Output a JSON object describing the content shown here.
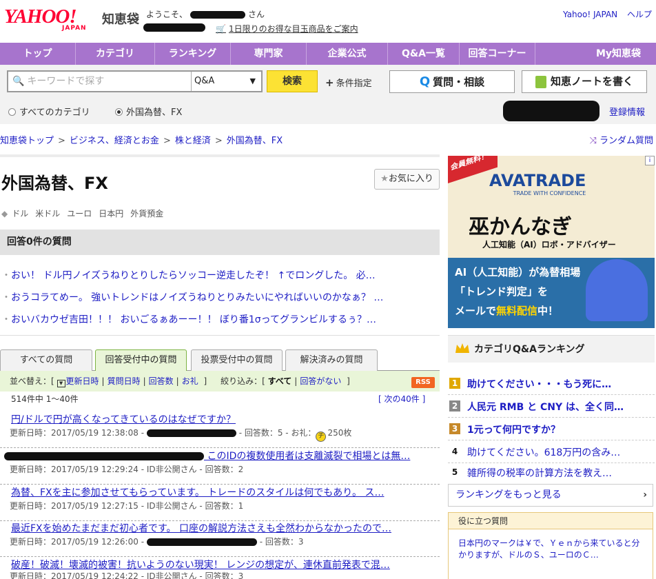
{
  "header": {
    "logo_main": "YAHOO!",
    "logo_sub": "JAPAN",
    "logo_service": "知恵袋",
    "welcome_prefix": "ようこそ、",
    "welcome_suffix": "さん",
    "promo": "1日限りのお得な目玉商品をご案内",
    "yahoo_japan_link": "Yahoo! JAPAN",
    "help_link": "ヘルプ"
  },
  "nav": {
    "items": [
      "トップ",
      "カテゴリ",
      "ランキング",
      "専門家",
      "企業公式",
      "Q&A一覧",
      "回答コーナー",
      "My知恵袋"
    ]
  },
  "search": {
    "placeholder": "キーワードで探す",
    "scope_value": "Q&A",
    "button": "検索",
    "conditions": "条件指定",
    "ask_button": "質問・相談",
    "note_button": "知恵ノートを書く",
    "radio_all": "すべてのカテゴリ",
    "radio_current": "外国為替、FX",
    "register": "登録情報"
  },
  "breadcrumb": {
    "items": [
      "知恵袋トップ",
      "ビジネス、経済とお金",
      "株と経済",
      "外国為替、FX"
    ],
    "random": "ランダム質問"
  },
  "category": {
    "title": "外国為替、FX",
    "favorite": "お気に入り",
    "tags": [
      "ドル",
      "米ドル",
      "ユーロ",
      "日本円",
      "外貨預金"
    ]
  },
  "zero_answers": {
    "heading": "回答0件の質問",
    "items": [
      "おい！ ドル円ノイズうねりとりしたらソッコー逆走したぞ！ ↑でロングした。 必…",
      "おうコラてめー。 強いトレンドはノイズうねりとりみたいにやればいいのかなぁ？ …",
      "おいバカウゼ吉田！！！ おいごるぁあーー！！ ぼり番1σってグランビルするぅ？…"
    ]
  },
  "tabs": [
    "すべての質問",
    "回答受付中の質問",
    "投票受付中の質問",
    "解決済みの質問"
  ],
  "sort": {
    "label": "並べ替え：[",
    "updated": "更新日時",
    "asked": "質問日時",
    "answers": "回答数",
    "reward": "お礼",
    "close": "]",
    "filter_label": "絞り込み：[",
    "all": "すべて",
    "no_answer": "回答がない",
    "filter_close": "]",
    "rss": "RSS",
    "count": "514件中 1〜40件",
    "next": "[ 次の40件 ]"
  },
  "questions": [
    {
      "title": "円/ドルで円が高くなってきているのはなぜですか？",
      "meta_date": "更新日時：2017/05/19 12:38:08 -",
      "meta_rest": "- 回答数：5 - お礼：",
      "coin": "チ",
      "reward": "250枚"
    },
    {
      "title": "このIDの複数使用者は支離滅裂で相場とは無…",
      "meta_date": "更新日時：2017/05/19 12:29:24 - ID非公開さん - 回答数：2",
      "meta_rest": "",
      "coin": "",
      "reward": ""
    },
    {
      "title": "為替、FXを主に参加させてもらっています。 トレードのスタイルは何でもあり。 ス…",
      "meta_date": "更新日時：2017/05/19 12:27:15 - ID非公開さん - 回答数：1",
      "meta_rest": "",
      "coin": "",
      "reward": ""
    },
    {
      "title": "最近FXを始めたまだまだ初心者です。 口座の解説方法さえも全然わからなかったので…",
      "meta_date": "更新日時：2017/05/19 12:26:00 -",
      "meta_rest": "- 回答数：3",
      "coin": "",
      "reward": ""
    },
    {
      "title": "破産！破滅！壊滅的被害！抗いようのない現実！ レンジの想定が、連休直前発表で混…",
      "meta_date": "更新日時：2017/05/19 12:24:22 - ID非公開さん - 回答数：3",
      "meta_rest": "",
      "coin": "",
      "reward": ""
    }
  ],
  "ad": {
    "badge": "会員無料！",
    "brand": "AVATRADE",
    "brand_sub": "TRADE WITH CONFIDENCE",
    "name": "巫かんなぎ",
    "sub": "人工知能（AI）ロボ・アドバイザー",
    "line1": "AI（人工知能）が為替相場",
    "line2": "「トレンド判定」を",
    "line3a": "メールで",
    "line3b": "無料配信",
    "line3c": "中！"
  },
  "ranking": {
    "heading": "カテゴリQ&Aランキング",
    "items": [
      {
        "n": "1",
        "t": "助けてください・・・もう死に…"
      },
      {
        "n": "2",
        "t": "人民元 RMB と CNY は、全く同…"
      },
      {
        "n": "3",
        "t": "1元って何円ですか？"
      },
      {
        "n": "4",
        "t": "助けてください。618万円の含み…"
      },
      {
        "n": "5",
        "t": "雑所得の税率の計算方法を教え…"
      }
    ],
    "more": "ランキングをもっと見る"
  },
  "useful": {
    "heading": "役に立つ質問",
    "body": "日本円のマークは￥で、Ｙｅｎから来ていると分かりますが、ドルのＳ、ユーロのＣ…"
  },
  "colors": {
    "nav": "#a774cd",
    "link": "#1d1dc4",
    "search_button": "#fce234"
  }
}
